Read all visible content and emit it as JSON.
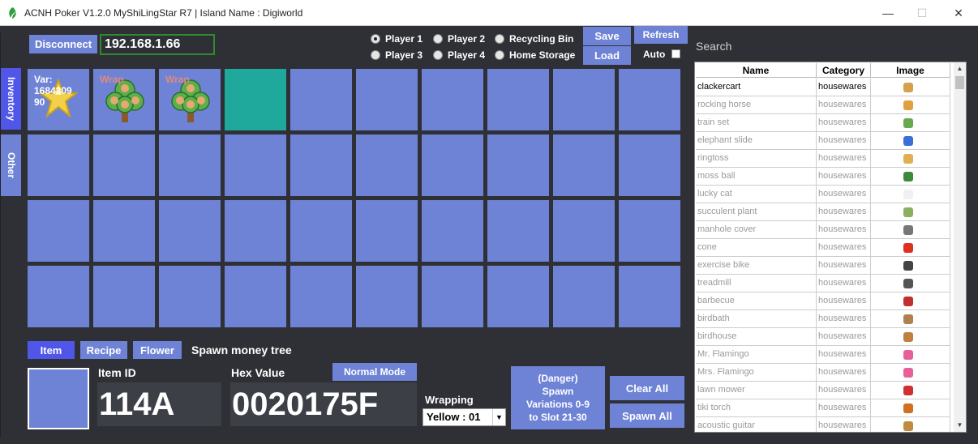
{
  "window": {
    "title": "ACNH Poker V1.2.0 MyShiLingStar R7  |  Island Name : Digiworld",
    "minimize": "—",
    "maximize": "☐",
    "close": "✕"
  },
  "connection": {
    "disconnect_label": "Disconnect",
    "ip_value": "192.168.1.66"
  },
  "side_tabs": {
    "inventory": "Inventory",
    "other": "Other"
  },
  "targets": [
    {
      "label": "Player 1",
      "selected": true
    },
    {
      "label": "Player 2",
      "selected": false
    },
    {
      "label": "Recycling Bin",
      "selected": false
    },
    {
      "label": "Player 3",
      "selected": false
    },
    {
      "label": "Player 4",
      "selected": false
    },
    {
      "label": "Home Storage",
      "selected": false
    }
  ],
  "toolbar": {
    "save_label": "Save",
    "load_label": "Load",
    "refresh_label": "Refresh",
    "auto_label": "Auto"
  },
  "inventory": {
    "slots": [
      {
        "text": "Var:\n1684309\n90",
        "icon": "star-fragment-icon"
      },
      {
        "text": "Wrap",
        "icon": "money-tree-icon"
      },
      {
        "text": "Wrap",
        "icon": "money-tree-icon"
      }
    ]
  },
  "bottom": {
    "item_tab": "Item",
    "recipe_tab": "Recipe",
    "flower_tab": "Flower",
    "spawn_money_label": "Spawn money tree",
    "item_id_label": "Item ID",
    "item_id_value": "114A",
    "hex_label": "Hex Value",
    "hex_value": "0020175F",
    "normal_mode_label": "Normal Mode",
    "wrapping_label": "Wrapping",
    "wrapping_value": "Yellow : 01",
    "danger_line1": "(Danger)",
    "danger_line2": "Spawn",
    "danger_line3": "Variations 0-9",
    "danger_line4": "to Slot 21-30",
    "clear_all_label": "Clear All",
    "spawn_all_label": "Spawn All"
  },
  "search": {
    "placeholder": "Search"
  },
  "item_table": {
    "headers": [
      "Name",
      "Category",
      "Image"
    ],
    "rows": [
      {
        "name": "clackercart",
        "category": "housewares",
        "icon": "clackercart-icon",
        "color": "#d4a24a"
      },
      {
        "name": "rocking horse",
        "category": "housewares",
        "icon": "rocking-horse-icon",
        "color": "#e0a040"
      },
      {
        "name": "train set",
        "category": "housewares",
        "icon": "train-set-icon",
        "color": "#6aa84f"
      },
      {
        "name": "elephant slide",
        "category": "housewares",
        "icon": "elephant-slide-icon",
        "color": "#3b6fd6"
      },
      {
        "name": "ringtoss",
        "category": "housewares",
        "icon": "ringtoss-icon",
        "color": "#e0b050"
      },
      {
        "name": "moss ball",
        "category": "housewares",
        "icon": "moss-ball-icon",
        "color": "#3c8a3c"
      },
      {
        "name": "lucky cat",
        "category": "housewares",
        "icon": "lucky-cat-icon",
        "color": "#f0f0f0"
      },
      {
        "name": "succulent plant",
        "category": "housewares",
        "icon": "succulent-plant-icon",
        "color": "#8ab060"
      },
      {
        "name": "manhole cover",
        "category": "housewares",
        "icon": "manhole-cover-icon",
        "color": "#777777"
      },
      {
        "name": "cone",
        "category": "housewares",
        "icon": "cone-icon",
        "color": "#e03020"
      },
      {
        "name": "exercise bike",
        "category": "housewares",
        "icon": "exercise-bike-icon",
        "color": "#444444"
      },
      {
        "name": "treadmill",
        "category": "housewares",
        "icon": "treadmill-icon",
        "color": "#555555"
      },
      {
        "name": "barbecue",
        "category": "housewares",
        "icon": "barbecue-icon",
        "color": "#c03030"
      },
      {
        "name": "birdbath",
        "category": "housewares",
        "icon": "birdbath-icon",
        "color": "#b08050"
      },
      {
        "name": "birdhouse",
        "category": "housewares",
        "icon": "birdhouse-icon",
        "color": "#c08040"
      },
      {
        "name": "Mr. Flamingo",
        "category": "housewares",
        "icon": "flamingo-icon",
        "color": "#e8609a"
      },
      {
        "name": "Mrs. Flamingo",
        "category": "housewares",
        "icon": "flamingo-icon",
        "color": "#e8609a"
      },
      {
        "name": "lawn mower",
        "category": "housewares",
        "icon": "lawn-mower-icon",
        "color": "#d03030"
      },
      {
        "name": "tiki torch",
        "category": "housewares",
        "icon": "tiki-torch-icon",
        "color": "#d07020"
      },
      {
        "name": "acoustic guitar",
        "category": "housewares",
        "icon": "acoustic-guitar-icon",
        "color": "#c08a40"
      }
    ]
  }
}
